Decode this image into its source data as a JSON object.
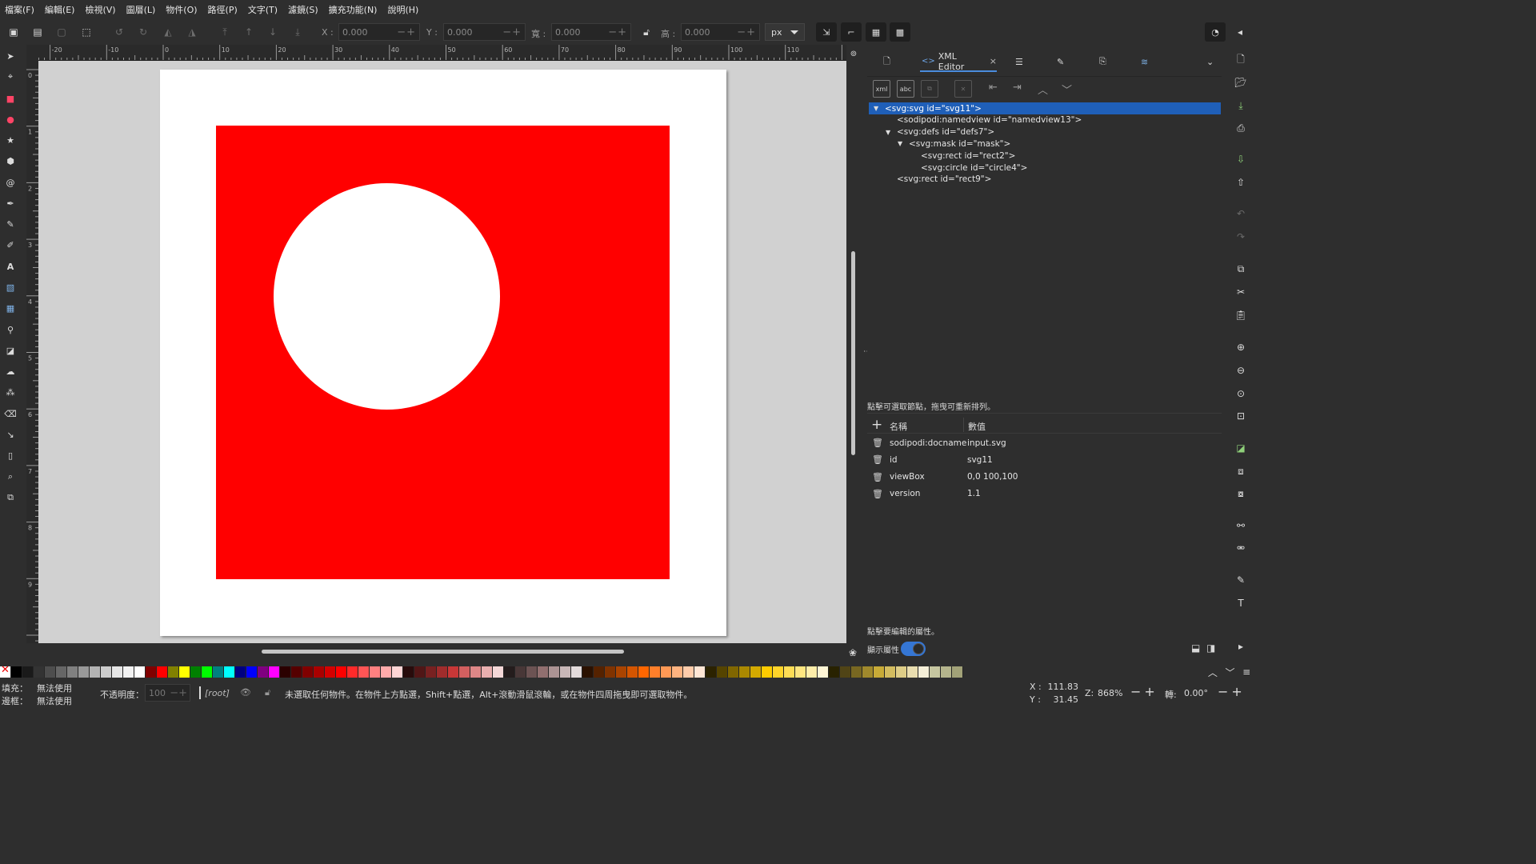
{
  "menubar": {
    "items": [
      "檔案(F)",
      "編輯(E)",
      "檢視(V)",
      "圖層(L)",
      "物件(O)",
      "路徑(P)",
      "文字(T)",
      "濾鏡(S)",
      "擴充功能(N)",
      "說明(H)"
    ]
  },
  "toolbar": {
    "x_label": "X :",
    "x_value": "0.000",
    "y_label": "Y :",
    "y_value": "0.000",
    "w_label": "寬 :",
    "w_value": "0.000",
    "h_label": "高 :",
    "h_value": "0.000",
    "unit": "px"
  },
  "rulers": {
    "top_labels": [
      "-20",
      "-10",
      "0",
      "10",
      "20",
      "30",
      "40",
      "50",
      "60",
      "70",
      "80",
      "90",
      "100",
      "110"
    ],
    "left_labels": [
      "0",
      "1",
      "2",
      "3",
      "4",
      "5",
      "6",
      "7",
      "8",
      "9"
    ]
  },
  "canvas": {
    "page_color": "#ffffff",
    "rect_color": "#ff0000",
    "circle_color": "#ffffff"
  },
  "dock": {
    "active_tab": "XML Editor",
    "tree_nodes": [
      {
        "text": "<svg:svg id=\"svg11\">",
        "depth": 0,
        "expander": "open",
        "selected": true
      },
      {
        "text": "<sodipodi:namedview id=\"namedview13\">",
        "depth": 1,
        "expander": "none",
        "selected": false
      },
      {
        "text": "<svg:defs id=\"defs7\">",
        "depth": 1,
        "expander": "open",
        "selected": false
      },
      {
        "text": "<svg:mask id=\"mask\">",
        "depth": 2,
        "expander": "open",
        "selected": false
      },
      {
        "text": "<svg:rect id=\"rect2\">",
        "depth": 3,
        "expander": "none",
        "selected": false
      },
      {
        "text": "<svg:circle id=\"circle4\">",
        "depth": 3,
        "expander": "none",
        "selected": false
      },
      {
        "text": "<svg:rect id=\"rect9\">",
        "depth": 1,
        "expander": "none",
        "selected": false
      }
    ],
    "tree_hint": "點擊可選取節點，拖曳可重新排列。",
    "attr_header_name": "名稱",
    "attr_header_value": "數值",
    "attributes": [
      {
        "name": "sodipodi:docname",
        "value": "input.svg"
      },
      {
        "name": "id",
        "value": "svg11"
      },
      {
        "name": "viewBox",
        "value": "0,0 100,100"
      },
      {
        "name": "version",
        "value": "1.1"
      }
    ],
    "attr_hint": "點擊要編輯的屬性。",
    "show_attrs_label": "顯示屬性"
  },
  "palette": {
    "colors": [
      "#000000",
      "#1a1a1a",
      "#333333",
      "#4d4d4d",
      "#666666",
      "#808080",
      "#999999",
      "#b3b3b3",
      "#cccccc",
      "#e6e6e6",
      "#f2f2f2",
      "#ffffff",
      "#800000",
      "#ff0000",
      "#808000",
      "#ffff00",
      "#008000",
      "#00ff00",
      "#008080",
      "#00ffff",
      "#000080",
      "#0000ff",
      "#800080",
      "#ff00ff",
      "#2b0000",
      "#550000",
      "#800000",
      "#aa0000",
      "#d40000",
      "#ff0000",
      "#ff2a2a",
      "#ff5555",
      "#ff8080",
      "#ffaaaa",
      "#ffd5d5",
      "#280b0b",
      "#501616",
      "#782121",
      "#a02c2c",
      "#c83737",
      "#d35f5f",
      "#de8787",
      "#e9afaf",
      "#f4d7d7",
      "#241c1c",
      "#483737",
      "#6c5353",
      "#916f6f",
      "#ac9393",
      "#c8b7b7",
      "#e3dbdb",
      "#2b1100",
      "#552200",
      "#803300",
      "#aa4400",
      "#d45500",
      "#ff6600",
      "#ff7f2a",
      "#ff9955",
      "#ffb380",
      "#ffccaa",
      "#ffe6d5",
      "#2b2200",
      "#554400",
      "#806600",
      "#aa8800",
      "#d4aa00",
      "#ffcc00",
      "#ffd42a",
      "#ffdd55",
      "#ffe680",
      "#ffeeaa",
      "#fff6d5",
      "#282200",
      "#504416",
      "#786721",
      "#a0892c",
      "#c8ab37",
      "#d3bc5f",
      "#decd87",
      "#e9ddaf",
      "#f4eed7",
      "#c6c6a0",
      "#b4b48c",
      "#a2a278"
    ]
  },
  "status": {
    "fill_label": "填充：",
    "fill_value": "無法使用",
    "stroke_label": "邊框：",
    "stroke_value": "無法使用",
    "opacity_label": "不透明度：",
    "opacity_value": "100",
    "layer_name": "[root]",
    "message": "未選取任何物件。在物件上方點選，Shift+點選，Alt+滾動滑鼠滾輪，或在物件四周拖曳即可選取物件。",
    "x_label": "X :",
    "x_value": "111.83",
    "y_label": "Y :",
    "y_value": "31.45",
    "zoom_label": "Z:",
    "zoom_value": "868%",
    "rotation_label": "轉:",
    "rotation_value": "0.00°"
  }
}
